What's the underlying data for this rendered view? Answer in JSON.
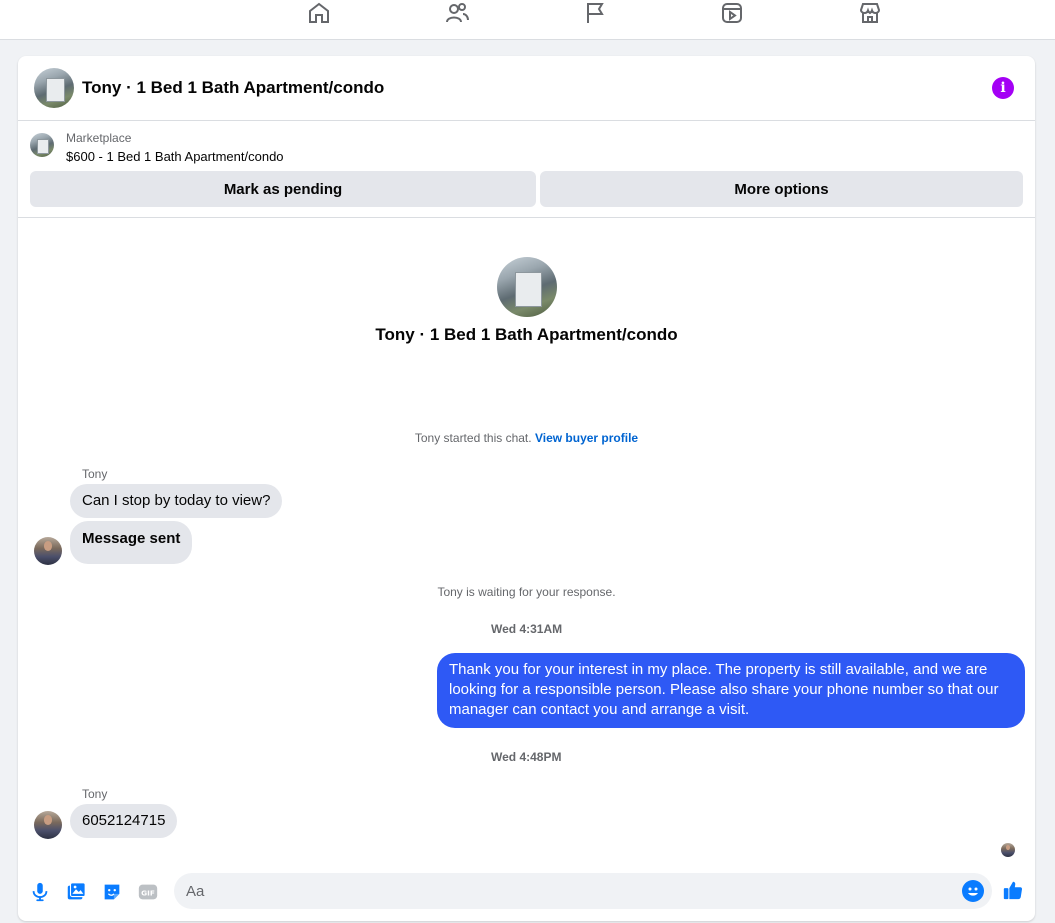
{
  "nav": {
    "items": [
      "home",
      "friends",
      "pages",
      "watch",
      "marketplace"
    ]
  },
  "header": {
    "title": "Tony · 1 Bed 1 Bath Apartment/condo"
  },
  "marketplace": {
    "label": "Marketplace",
    "item": "$600 - 1 Bed 1 Bath Apartment/condo",
    "mark_pending": "Mark as pending",
    "more_options": "More options"
  },
  "conversation": {
    "title": "Tony · 1 Bed 1 Bath Apartment/condo",
    "started": "Tony started this chat.",
    "view_profile": "View buyer profile",
    "sender1": "Tony",
    "msg1": "Can I stop by today to view?",
    "msg2": "Message sent",
    "waiting": "Tony is waiting for your response.",
    "time1": "Wed 4:31AM",
    "reply": "Thank you for your interest in my place. The property is still available, and we are looking for a responsible person. Please also share your phone number so that our manager can contact you and arrange a visit.",
    "time2": "Wed 4:48PM",
    "sender2": "Tony",
    "msg3": "6052124715"
  },
  "composer": {
    "placeholder": "Aa"
  },
  "colors": {
    "accent": "#2e59f5",
    "info": "#a400f5",
    "link": "#0064d1"
  }
}
